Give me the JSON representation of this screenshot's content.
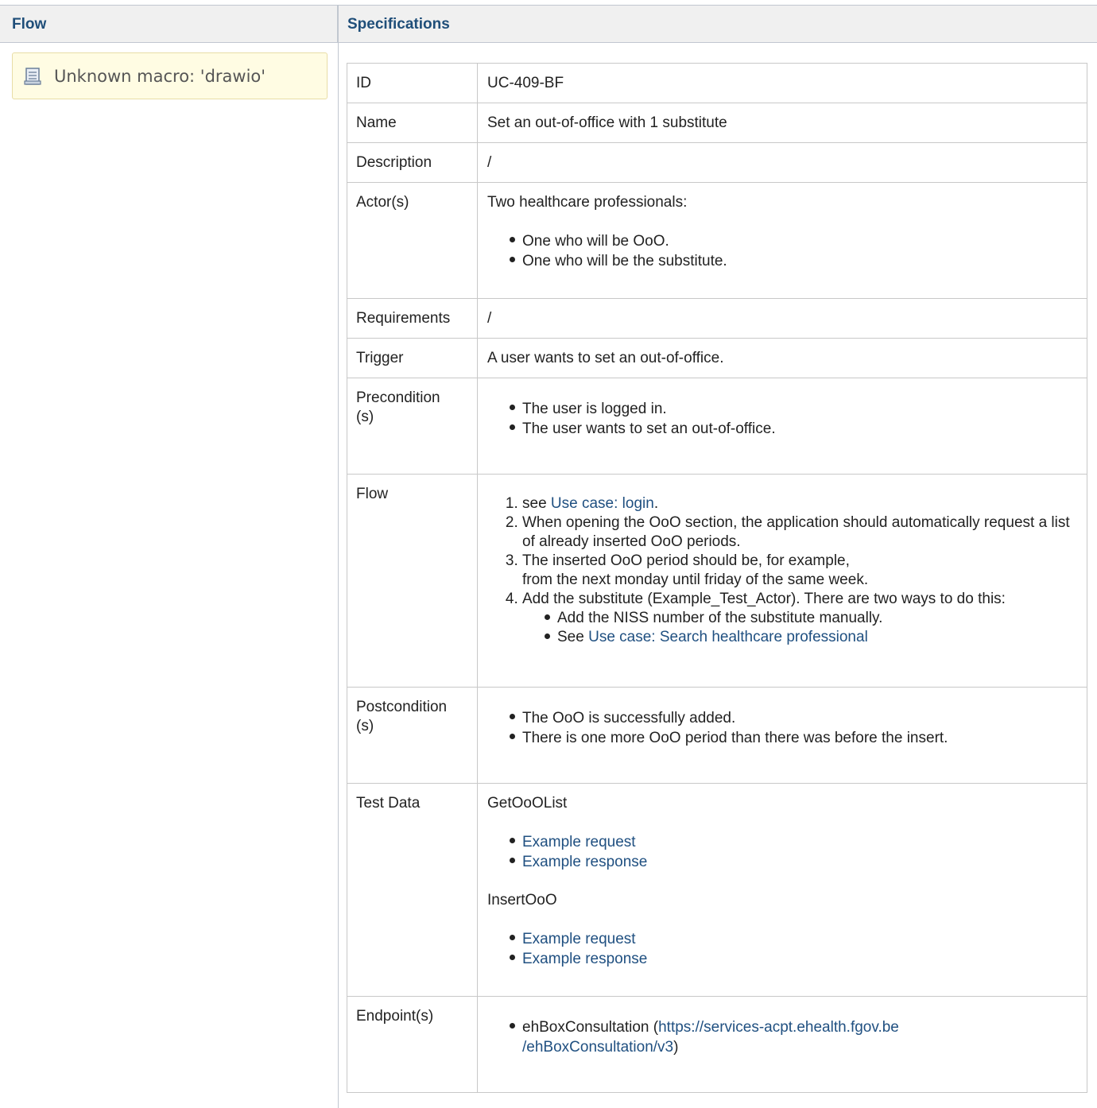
{
  "headers": {
    "flow": "Flow",
    "specifications": "Specifications"
  },
  "macro": {
    "text": "Unknown macro: 'drawio'",
    "icon": "document-icon"
  },
  "spec": {
    "id": {
      "key": "ID",
      "value": "UC-409-BF"
    },
    "name": {
      "key": "Name",
      "value": "Set an out-of-office with 1 substitute"
    },
    "description": {
      "key": "Description",
      "value": "/"
    },
    "actors": {
      "key": "Actor(s)",
      "intro": "Two healthcare professionals:",
      "items": [
        "One who will be OoO.",
        "One who will be the substitute."
      ]
    },
    "requirements": {
      "key": "Requirements",
      "value": "/"
    },
    "trigger": {
      "key": "Trigger",
      "value": "A user wants to set an out-of-office."
    },
    "precondition": {
      "key": "Precondition\n(s)",
      "items": [
        "The user is logged in.",
        "The user wants to set an out-of-office."
      ]
    },
    "flow": {
      "key": "Flow",
      "step1_prefix": "see ",
      "step1_link": "Use case: login",
      "step1_suffix": ".",
      "step2": "When opening the OoO section, the application should automatically request a list of already inserted OoO periods.",
      "step3a": "The inserted OoO period should be, for example,",
      "step3b": "from the next monday until friday of the same week.",
      "step4": "Add the substitute (Example_Test_Actor). There are two ways to do this:",
      "sub1": "Add the NISS number of the substitute manually.",
      "sub2_prefix": "See ",
      "sub2_link": "Use case: Search healthcare professional"
    },
    "postcondition": {
      "key": "Postcondition\n(s)",
      "items": [
        "The OoO is successfully added.",
        "There is one more OoO period than there was before the insert."
      ]
    },
    "testdata": {
      "key": "Test Data",
      "group1": "GetOoOList",
      "group1_links": [
        "Example request",
        "Example response"
      ],
      "group2": "InsertOoO",
      "group2_links": [
        "Example request",
        "Example response"
      ]
    },
    "endpoints": {
      "key": "Endpoint(s)",
      "service": "ehBoxConsultation",
      "open_paren": " (",
      "url_line1": "https://services-acpt.ehealth.fgov.be",
      "url_line2": "/ehBoxConsultation/v3",
      "close_paren": ")"
    }
  }
}
